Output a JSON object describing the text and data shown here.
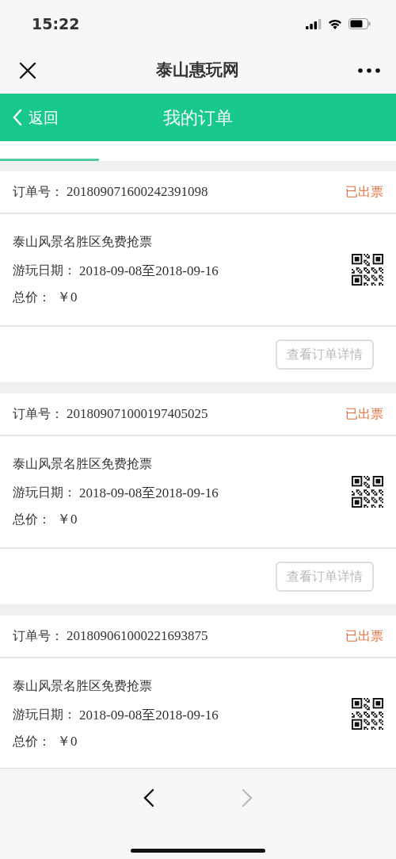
{
  "status_bar": {
    "time": "15:22"
  },
  "title_bar": {
    "title": "泰山惠玩网"
  },
  "header": {
    "back": "返回",
    "title": "我的订单"
  },
  "tabs": [
    {
      "selected": true
    },
    {
      "selected": false
    },
    {
      "selected": false
    },
    {
      "selected": false
    }
  ],
  "orders": [
    {
      "order_label": "订单号：",
      "order_no": "201809071600242391098",
      "status": "已出票",
      "name": "泰山风景名胜区免费抢票",
      "date_label": "游玩日期：",
      "dates": "2018-09-08至2018-09-16",
      "price_label": "总价：",
      "price": "￥0",
      "button": "查看订单详情"
    },
    {
      "order_label": "订单号：",
      "order_no": "201809071000197405025",
      "status": "已出票",
      "name": "泰山风景名胜区免费抢票",
      "date_label": "游玩日期：",
      "dates": "2018-09-08至2018-09-16",
      "price_label": "总价：",
      "price": "￥0",
      "button": "查看订单详情"
    },
    {
      "order_label": "订单号：",
      "order_no": "201809061000221693875",
      "status": "已出票",
      "name": "泰山风景名胜区免费抢票",
      "date_label": "游玩日期：",
      "dates": "2018-09-08至2018-09-16",
      "price_label": "总价：",
      "price": "￥0"
    }
  ],
  "toolbar": {
    "back_enabled": true,
    "forward_enabled": false
  }
}
